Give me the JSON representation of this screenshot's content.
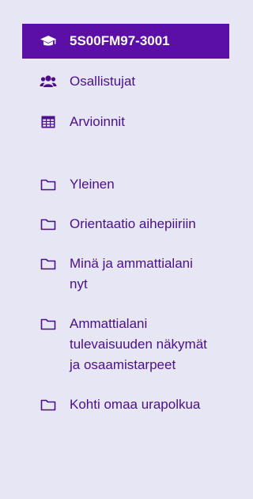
{
  "course": {
    "code": "5S00FM97-3001",
    "icon": "graduation-cap-icon"
  },
  "nav": {
    "participants": {
      "label": "Osallistujat",
      "icon": "users-icon"
    },
    "grades": {
      "label": "Arvioinnit",
      "icon": "table-icon"
    }
  },
  "sections": [
    {
      "label": "Yleinen",
      "icon": "folder-icon"
    },
    {
      "label": "Orientaatio aihepiiriin",
      "icon": "folder-icon"
    },
    {
      "label": "Minä ja ammattialani nyt",
      "icon": "folder-icon"
    },
    {
      "label": "Ammattialani tulevaisuuden näkymät ja osaamistarpeet",
      "icon": "folder-icon"
    },
    {
      "label": "Kohti omaa urapolkua",
      "icon": "folder-icon"
    }
  ],
  "colors": {
    "background": "#e6e6f5",
    "active_bg": "#5b0fa6",
    "accent": "#4c0f8a",
    "active_text": "#ffffff"
  }
}
